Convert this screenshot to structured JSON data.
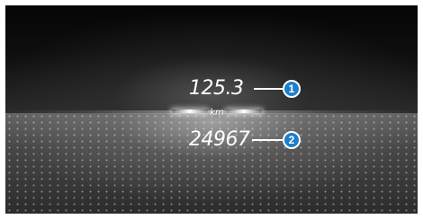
{
  "display": {
    "trip_distance": "125.3",
    "unit": "km",
    "total_distance": "24967"
  },
  "callouts": [
    {
      "number": "1"
    },
    {
      "number": "2"
    }
  ],
  "colors": {
    "callout_fill": "#1e7fc9",
    "text": "#ffffff",
    "background": "#000000"
  }
}
